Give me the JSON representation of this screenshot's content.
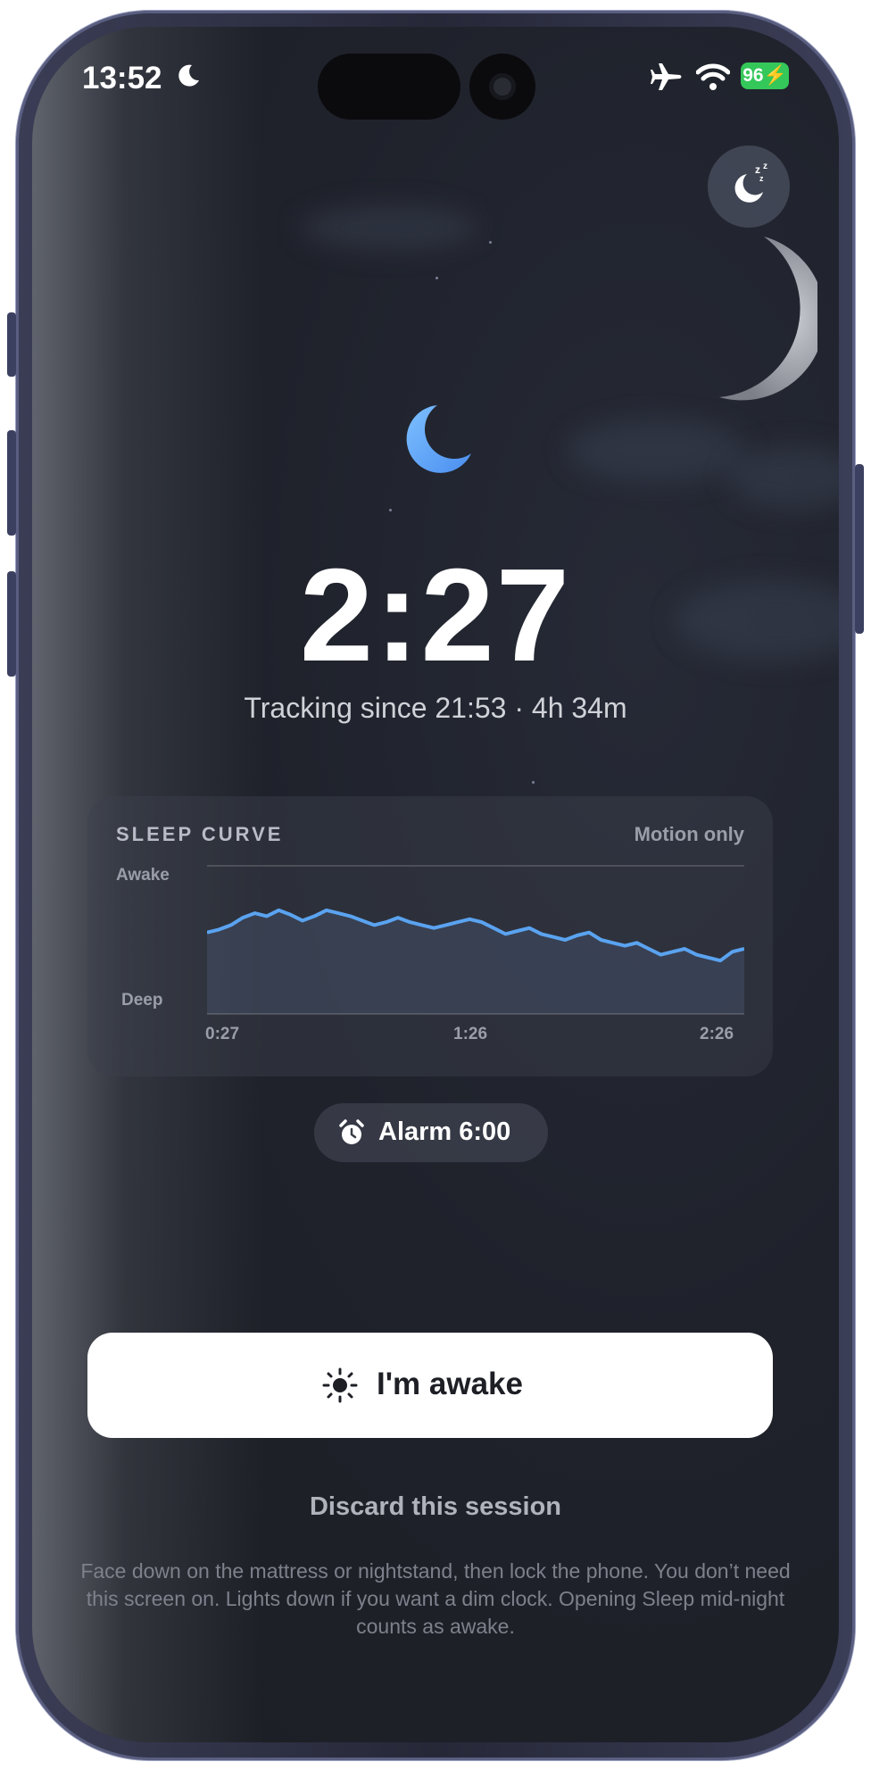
{
  "status_bar": {
    "time": "13:52",
    "battery": "96",
    "icons": [
      "moon-icon",
      "airplane-icon",
      "wifi-icon",
      "battery-charging-icon"
    ]
  },
  "top_action": {
    "icon": "sleep-zzz-icon"
  },
  "clock": {
    "time": "2:27"
  },
  "tracking": {
    "text": "Tracking since 21:53 · 4h 34m"
  },
  "sleep_card": {
    "title": "SLEEP CURVE",
    "mode": "Motion only",
    "y_top_label": "Awake",
    "y_bottom_label": "Deep",
    "x_labels": [
      "0:27",
      "1:26",
      "2:26"
    ]
  },
  "chart_data": {
    "type": "area",
    "title": "SLEEP CURVE",
    "series": [
      {
        "values": [
          0.55,
          0.57,
          0.6,
          0.65,
          0.68,
          0.66,
          0.7,
          0.67,
          0.63,
          0.66,
          0.7,
          0.68,
          0.66,
          0.63,
          0.6,
          0.62,
          0.65,
          0.62,
          0.6,
          0.58,
          0.6,
          0.62,
          0.64,
          0.62,
          0.58,
          0.54,
          0.56,
          0.58,
          0.54,
          0.52,
          0.5,
          0.53,
          0.55,
          0.5,
          0.48,
          0.46,
          0.48,
          0.44,
          0.4,
          0.42,
          0.44,
          0.4,
          0.38,
          0.36,
          0.42,
          0.44
        ]
      }
    ],
    "x_tick_labels": [
      "0:27",
      "1:26",
      "2:26"
    ],
    "y_labels": [
      "Awake",
      "Deep"
    ],
    "ylim": [
      0,
      1
    ],
    "color": "#5aa3f0"
  },
  "alarm": {
    "label": "Alarm 6:00",
    "icon": "alarm-clock-icon"
  },
  "primary_button": {
    "label": "I'm awake",
    "icon": "sun-icon"
  },
  "discard": {
    "label": "Discard this session"
  },
  "hint": {
    "text": "Face down on the mattress or nightstand, then lock the phone. You don’t need this screen on. Lights down if you want a dim clock. Opening Sleep mid-night counts as awake."
  },
  "colors": {
    "background": "#1f222b",
    "accent": "#5aa3f0",
    "battery": "#34c759"
  }
}
